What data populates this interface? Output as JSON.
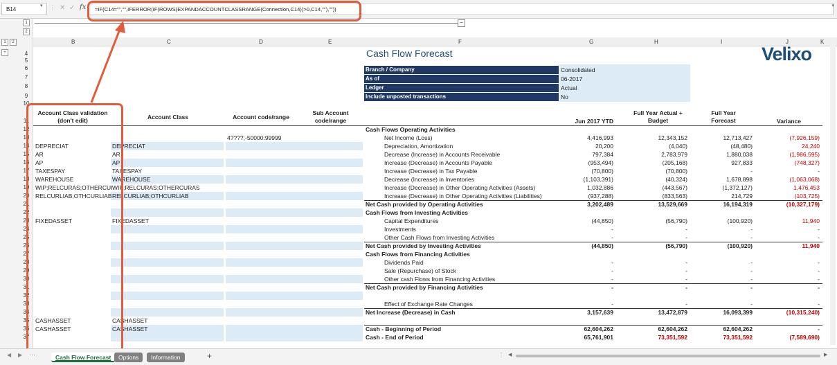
{
  "formula_bar": {
    "name_box": "B14",
    "formula": "=IF(C14=\"\",\"\",IFERROR(IF(ROWS(EXPANDACCOUNTCLASSRANGE(Connection,C14))>0,C14,\"\"),\"\"))"
  },
  "columns": [
    "B",
    "C",
    "D",
    "E",
    "F",
    "G",
    "H",
    "I",
    "J",
    "K"
  ],
  "rows": [
    "4",
    "5",
    "6",
    "7",
    "8",
    "9",
    "10",
    "11",
    "12",
    "13",
    "14",
    "15",
    "16",
    "17",
    "18",
    "19",
    "20",
    "21",
    "22",
    "23",
    "24",
    "25",
    "26",
    "27",
    "28",
    "29",
    "30",
    "31",
    "32",
    "33",
    "34",
    "35",
    "36",
    "37"
  ],
  "outline": {
    "levels": [
      "1",
      "2"
    ],
    "rows": [
      "1",
      "2"
    ],
    "expand": "+",
    "collapse": "−"
  },
  "title": "Cash Flow Forecast",
  "logo": "Velixo",
  "params": [
    {
      "label": "Branch / Company",
      "value": "Consolidated"
    },
    {
      "label": "As of",
      "value": "06-2017"
    },
    {
      "label": "Ledger",
      "value": "Actual"
    },
    {
      "label": "Include unposted transactions",
      "value": "No"
    }
  ],
  "headers": {
    "b": "Account Class validation (don't edit)",
    "c": "Account Class",
    "d": "Account code/range",
    "e": "Sub Account code/range",
    "g": "Jun 2017 YTD",
    "h": "Full Year Actual + Budget",
    "i": "Full Year Forecast",
    "j": "Variance"
  },
  "left_rows": [
    {
      "b": "",
      "c": "",
      "d": "4????;-50000:99999"
    },
    {
      "b": "DEPRECIAT",
      "c": "DEPRECIAT",
      "d": ""
    },
    {
      "b": "AR",
      "c": "AR",
      "d": ""
    },
    {
      "b": "AP",
      "c": "AP",
      "d": ""
    },
    {
      "b": "TAXESPAY",
      "c": "TAXESPAY",
      "d": ""
    },
    {
      "b": "WAREHOUSE",
      "c": "WAREHOUSE",
      "d": ""
    },
    {
      "b": "WIP;RELCURAS;OTHERCUI",
      "c": "WIP;RELCURAS;OTHERCURAS",
      "d": ""
    },
    {
      "b": "RELCURLIAB;OTHCURLIAB",
      "c": "RELCURLIAB;OTHCURLIAB",
      "d": ""
    },
    {
      "b": "",
      "c": "",
      "d": ""
    },
    {
      "b": "",
      "c": "",
      "d": ""
    },
    {
      "b": "FIXEDASSET",
      "c": "FIXEDASSET",
      "d": ""
    },
    {
      "b": "",
      "c": "",
      "d": ""
    },
    {
      "b": "",
      "c": "",
      "d": ""
    },
    {
      "b": "",
      "c": "",
      "d": ""
    },
    {
      "b": "",
      "c": "",
      "d": ""
    },
    {
      "b": "",
      "c": "",
      "d": ""
    },
    {
      "b": "",
      "c": "",
      "d": ""
    },
    {
      "b": "",
      "c": "",
      "d": ""
    },
    {
      "b": "",
      "c": "",
      "d": ""
    },
    {
      "b": "",
      "c": "",
      "d": ""
    },
    {
      "b": "",
      "c": "",
      "d": ""
    },
    {
      "b": "",
      "c": "",
      "d": ""
    },
    {
      "b": "CASHASSET",
      "c": "CASHASSET",
      "d": ""
    },
    {
      "b": "CASHASSET",
      "c": "CASHASSET",
      "d": ""
    }
  ],
  "lines": [
    {
      "f": "Cash Flows Operating Activities",
      "g": "",
      "h": "",
      "i": "",
      "j": "",
      "t": "sec"
    },
    {
      "f": "Net Income (Loss)",
      "g": "4,416,993",
      "h": "12,343,152",
      "i": "12,713,427",
      "j": "(7,926,159)",
      "t": "item"
    },
    {
      "f": "Depreciation, Amortization",
      "g": "20,200",
      "h": "(4,040)",
      "i": "(48,480)",
      "j": "24,240",
      "t": "item"
    },
    {
      "f": "Decrease (Increase) in Accounts Receivable",
      "g": "797,384",
      "h": "2,783,979",
      "i": "1,880,038",
      "j": "(1,986,595)",
      "t": "item"
    },
    {
      "f": "Increase (Decrease) in Accounts Payable",
      "g": "(953,494)",
      "h": "(205,168)",
      "i": "927,833",
      "j": "(748,327)",
      "t": "item"
    },
    {
      "f": "Increase (Decrease) in Tax Payable",
      "g": "(70,800)",
      "h": "(70,800)",
      "i": "-",
      "j": "-",
      "t": "item"
    },
    {
      "f": "Decrease (Increase) in Inventories",
      "g": "(1,103,391)",
      "h": "(40,324)",
      "i": "1,678,898",
      "j": "(1,063,068)",
      "t": "item"
    },
    {
      "f": "Increase (Decrease) in Other Operating Activities (Assets)",
      "g": "1,032,886",
      "h": "(443,567)",
      "i": "(1,372,127)",
      "j": "1,476,453",
      "t": "item"
    },
    {
      "f": "Increase (Decrease) in Other Operating Activities (Liabilities)",
      "g": "(937,288)",
      "h": "(833,563)",
      "i": "214,729",
      "j": "(103,725)",
      "t": "item"
    },
    {
      "f": "Net Cash provided by Operating Activities",
      "g": "3,202,489",
      "h": "13,529,669",
      "i": "16,194,319",
      "j": "(10,327,179)",
      "t": "total"
    },
    {
      "f": "Cash Flows from Investing Activities",
      "g": "",
      "h": "",
      "i": "",
      "j": "",
      "t": "sec"
    },
    {
      "f": "Capital Expenditures",
      "g": "(44,850)",
      "h": "(56,790)",
      "i": "(100,920)",
      "j": "11,940",
      "t": "item"
    },
    {
      "f": "Investments",
      "g": "-",
      "h": "-",
      "i": "-",
      "j": "-",
      "t": "item"
    },
    {
      "f": "Other Cash Flows from Investing Activities",
      "g": "-",
      "h": "-",
      "i": "-",
      "j": "-",
      "t": "item"
    },
    {
      "f": "Net Cash provided by Investing Activities",
      "g": "(44,850)",
      "h": "(56,790)",
      "i": "(100,920)",
      "j": "11,940",
      "t": "total"
    },
    {
      "f": "Cash Flows from Financing Activities",
      "g": "",
      "h": "",
      "i": "",
      "j": "",
      "t": "sec"
    },
    {
      "f": "Dividends Paid",
      "g": "-",
      "h": "-",
      "i": "-",
      "j": "-",
      "t": "item"
    },
    {
      "f": "Sale (Repurchase) of Stock",
      "g": "-",
      "h": "-",
      "i": "-",
      "j": "-",
      "t": "item"
    },
    {
      "f": "Other cash Flows from Financing Activities",
      "g": "-",
      "h": "-",
      "i": "-",
      "j": "-",
      "t": "item"
    },
    {
      "f": "Net Cash provided by Financing Activities",
      "g": "-",
      "h": "-",
      "i": "-",
      "j": "-",
      "t": "total"
    },
    {
      "f": "",
      "g": "",
      "h": "",
      "i": "",
      "j": "",
      "t": "blank"
    },
    {
      "f": "Effect of Exchange Rate Changes",
      "g": "-",
      "h": "-",
      "i": "-",
      "j": "-",
      "t": "item"
    },
    {
      "f": "Net Increase (Decrease) in Cash",
      "g": "3,157,639",
      "h": "13,472,879",
      "i": "16,093,399",
      "j": "(10,315,240)",
      "t": "total"
    },
    {
      "f": "",
      "g": "",
      "h": "",
      "i": "",
      "j": "",
      "t": "blank"
    },
    {
      "f": "Cash - Beginning of Period",
      "g": "62,604,262",
      "h": "62,604,262",
      "i": "62,604,262",
      "j": "-",
      "t": "sec2"
    },
    {
      "f": "Cash - End of Period",
      "g": "65,761,901",
      "h": "73,351,592",
      "i": "73,351,592",
      "j": "(7,589,690)",
      "t": "sec2"
    }
  ],
  "tabs": [
    "Cash Flow Forecast",
    "Options",
    "Information"
  ],
  "add_sheet": "+",
  "colors": {
    "accent": "#e25b3b",
    "navy": "#1f3864",
    "input_fill": "#ddebf7",
    "negative": "#c00000"
  }
}
